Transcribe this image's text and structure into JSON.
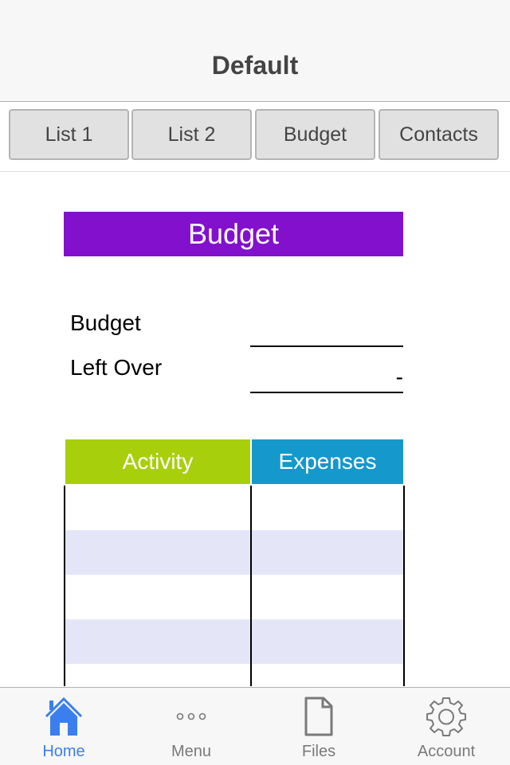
{
  "header": {
    "title": "Default"
  },
  "segments": [
    {
      "label": "List 1"
    },
    {
      "label": "List 2"
    },
    {
      "label": "Budget"
    },
    {
      "label": "Contacts"
    }
  ],
  "banner": {
    "title": "Budget",
    "color": "#8210cc"
  },
  "summary": {
    "budget_label": "Budget",
    "budget_value": "",
    "leftover_label": "Left Over",
    "leftover_value": "-"
  },
  "table": {
    "columns": [
      {
        "label": "Activity",
        "color": "#a8cf0c"
      },
      {
        "label": "Expenses",
        "color": "#1598cc"
      }
    ],
    "rows": [
      {
        "activity": "",
        "expense": ""
      },
      {
        "activity": "",
        "expense": ""
      },
      {
        "activity": "",
        "expense": ""
      },
      {
        "activity": "",
        "expense": ""
      },
      {
        "activity": "",
        "expense": ""
      }
    ],
    "stripe_color": "#e4e6f8"
  },
  "tabbar": {
    "active_color": "#3b7fef",
    "items": [
      {
        "label": "Home",
        "icon": "home-icon",
        "active": true
      },
      {
        "label": "Menu",
        "icon": "more-icon",
        "active": false
      },
      {
        "label": "Files",
        "icon": "file-icon",
        "active": false
      },
      {
        "label": "Account",
        "icon": "gear-icon",
        "active": false
      }
    ]
  }
}
